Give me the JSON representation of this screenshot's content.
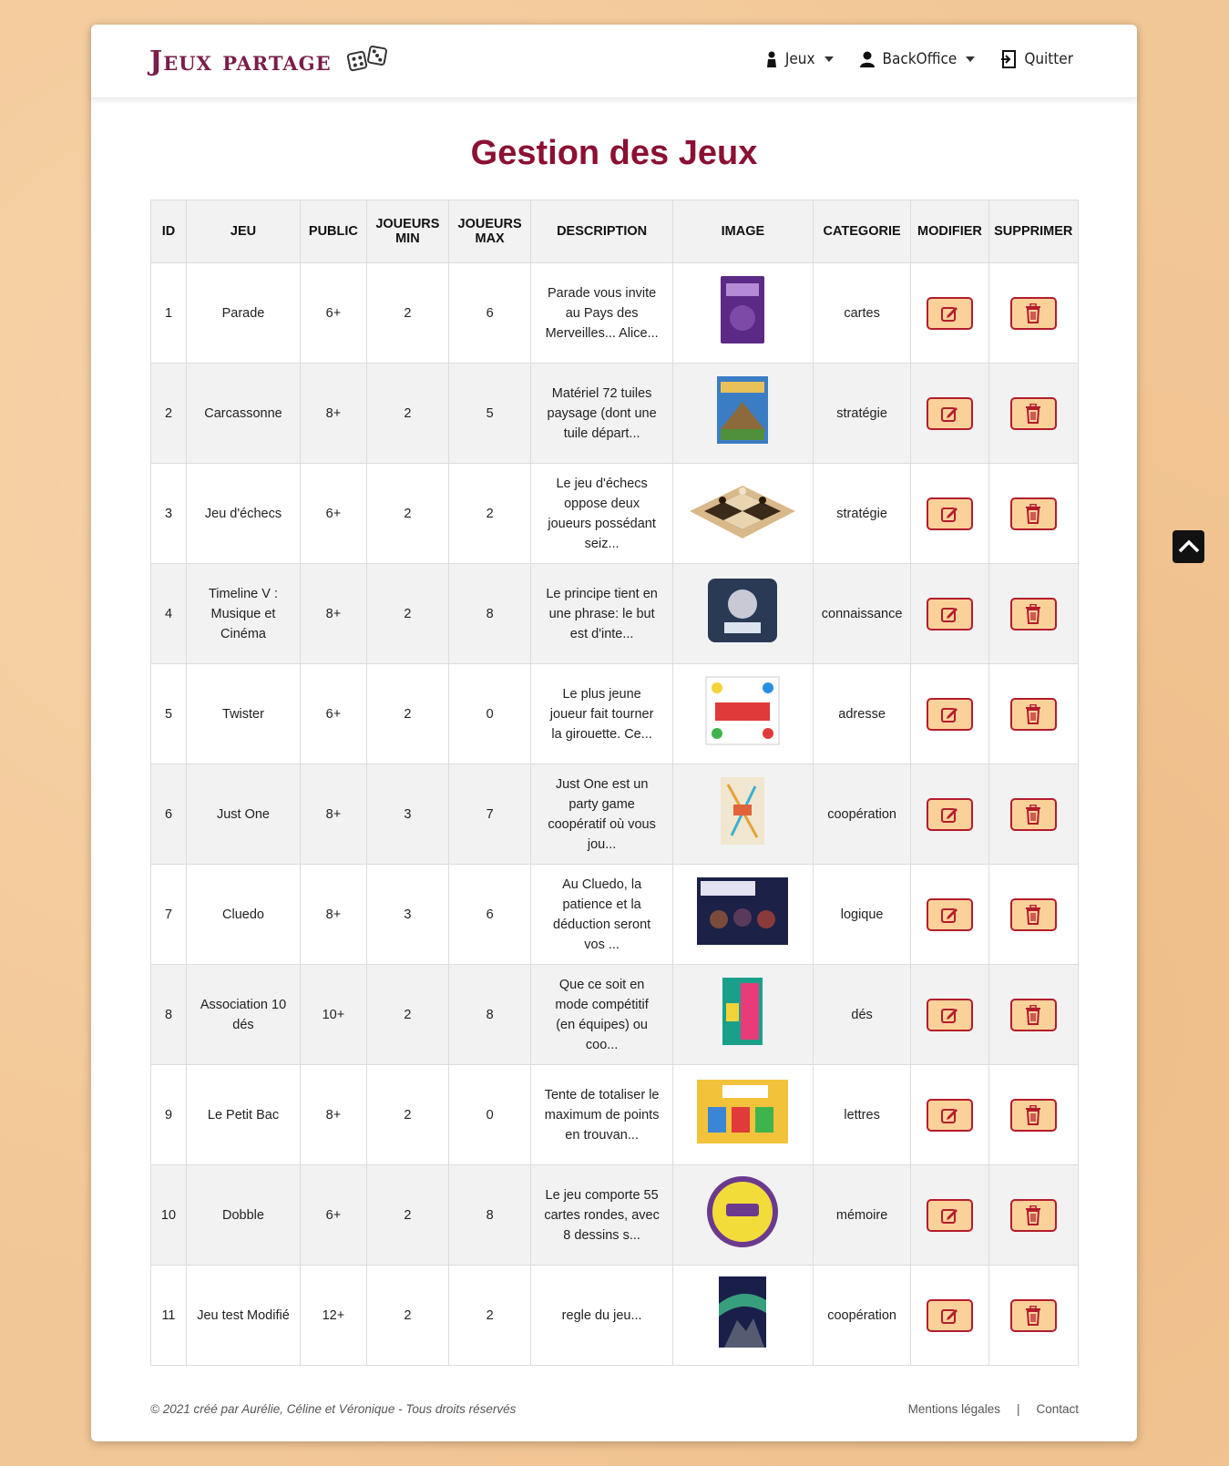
{
  "brand": {
    "name": "Jeux partage",
    "icon": "dice-icon"
  },
  "nav": {
    "jeux": "Jeux",
    "backoffice": "BackOffice",
    "quitter": "Quitter"
  },
  "page_title": "Gestion des Jeux",
  "table": {
    "headers": [
      "ID",
      "JEU",
      "PUBLIC",
      "JOUEURS MIN",
      "JOUEURS MAX",
      "DESCRIPTION",
      "IMAGE",
      "CATEGORIE",
      "MODIFIER",
      "SUPPRIMER"
    ],
    "rows": [
      {
        "id": "1",
        "jeu": "Parade",
        "public": "6+",
        "min": "2",
        "max": "6",
        "desc": "Parade vous invite au Pays des Merveilles... Alice...",
        "cat": "cartes"
      },
      {
        "id": "2",
        "jeu": "Carcassonne",
        "public": "8+",
        "min": "2",
        "max": "5",
        "desc": "Matériel 72 tuiles paysage (dont une tuile départ...",
        "cat": "stratégie"
      },
      {
        "id": "3",
        "jeu": "Jeu d'échecs",
        "public": "6+",
        "min": "2",
        "max": "2",
        "desc": "Le jeu d'échecs oppose deux joueurs possédant seiz...",
        "cat": "stratégie"
      },
      {
        "id": "4",
        "jeu": "Timeline V : Musique et Cinéma",
        "public": "8+",
        "min": "2",
        "max": "8",
        "desc": "Le principe tient en une phrase: le but est d'inte...",
        "cat": "connaissance"
      },
      {
        "id": "5",
        "jeu": "Twister",
        "public": "6+",
        "min": "2",
        "max": "0",
        "desc": "Le plus jeune joueur fait tourner la girouette. Ce...",
        "cat": "adresse"
      },
      {
        "id": "6",
        "jeu": "Just One",
        "public": "8+",
        "min": "3",
        "max": "7",
        "desc": "Just One est un party game coopératif où vous jou...",
        "cat": "coopération"
      },
      {
        "id": "7",
        "jeu": "Cluedo",
        "public": "8+",
        "min": "3",
        "max": "6",
        "desc": "Au Cluedo, la patience et la déduction seront vos ...",
        "cat": "logique"
      },
      {
        "id": "8",
        "jeu": "Association 10 dés",
        "public": "10+",
        "min": "2",
        "max": "8",
        "desc": "Que ce soit en mode compétitif (en équipes) ou coo...",
        "cat": "dés"
      },
      {
        "id": "9",
        "jeu": "Le Petit Bac",
        "public": "8+",
        "min": "2",
        "max": "0",
        "desc": "Tente de totaliser le maximum de points en trouvan...",
        "cat": "lettres"
      },
      {
        "id": "10",
        "jeu": "Dobble",
        "public": "6+",
        "min": "2",
        "max": "8",
        "desc": "Le jeu comporte 55 cartes rondes, avec 8 dessins s...",
        "cat": "mémoire"
      },
      {
        "id": "11",
        "jeu": "Jeu test Modifié",
        "public": "12+",
        "min": "2",
        "max": "2",
        "desc": "regle du jeu...",
        "cat": "coopération"
      }
    ]
  },
  "footer": {
    "copyright": "© 2021 créé par Aurélie, Céline et Véronique - Tous droits réservés",
    "mentions": "Mentions légales",
    "separator": "|",
    "contact": "Contact"
  },
  "colors": {
    "brand": "#7a1d4a",
    "title": "#8b1034",
    "button_border": "#b41c2c",
    "button_bg": "#fbd19a"
  }
}
